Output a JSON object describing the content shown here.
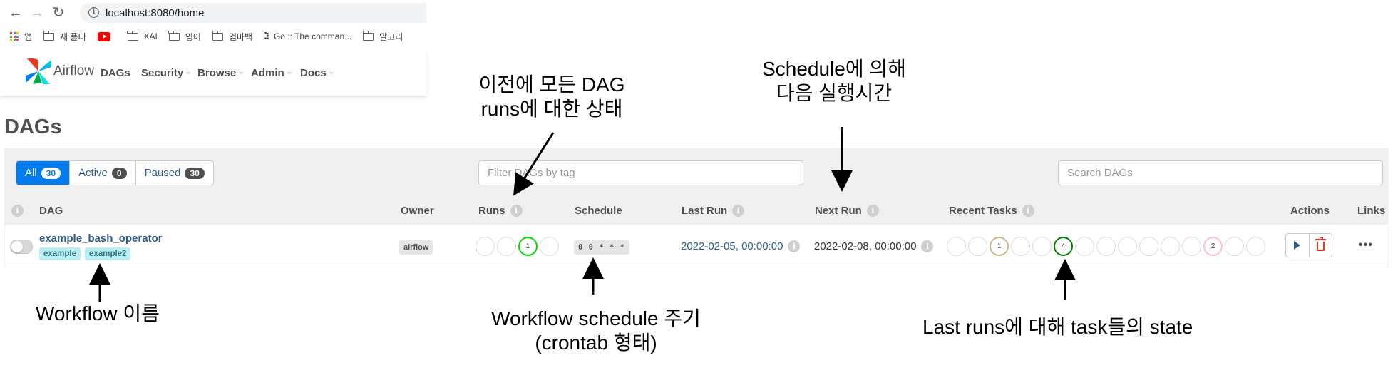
{
  "browser": {
    "url": "localhost:8080/home",
    "bookmarks": [
      {
        "icon": "apps-grid-icon",
        "label": "앱"
      },
      {
        "icon": "folder-icon",
        "label": "새 폴더"
      },
      {
        "icon": "youtube-icon",
        "label": ""
      },
      {
        "icon": "folder-icon",
        "label": "XAI"
      },
      {
        "icon": "folder-icon",
        "label": "영어"
      },
      {
        "icon": "folder-icon",
        "label": "엄마백"
      },
      {
        "icon": "go-gopher-icon",
        "label": "Go :: The comman..."
      },
      {
        "icon": "folder-icon",
        "label": "알고리"
      }
    ]
  },
  "navbar": {
    "brand": "Airflow",
    "items": [
      {
        "label": "DAGs",
        "dropdown": false
      },
      {
        "label": "Security",
        "dropdown": true
      },
      {
        "label": "Browse",
        "dropdown": true
      },
      {
        "label": "Admin",
        "dropdown": true
      },
      {
        "label": "Docs",
        "dropdown": true
      }
    ]
  },
  "page": {
    "title": "DAGs",
    "status_filters": [
      {
        "label": "All",
        "count": "30",
        "active": true
      },
      {
        "label": "Active",
        "count": "0",
        "active": false
      },
      {
        "label": "Paused",
        "count": "30",
        "active": false
      }
    ],
    "tag_filter_placeholder": "Filter DAGs by tag",
    "search_placeholder": "Search DAGs"
  },
  "table": {
    "headers": {
      "dag": "DAG",
      "owner": "Owner",
      "runs": "Runs",
      "schedule": "Schedule",
      "last_run": "Last Run",
      "next_run": "Next Run",
      "recent_tasks": "Recent Tasks",
      "actions": "Actions",
      "links": "Links"
    },
    "rows": [
      {
        "dag_id": "example_bash_operator",
        "paused": true,
        "tags": [
          "example",
          "example2"
        ],
        "owner": "airflow",
        "runs": [
          {
            "count": "",
            "color": "#dcdcdc"
          },
          {
            "count": "",
            "color": "#dcdcdc"
          },
          {
            "count": "1",
            "color": "#00e000",
            "state": "success"
          },
          {
            "count": "",
            "color": "#dcdcdc"
          }
        ],
        "schedule": "0 0 * * *",
        "last_run": "2022-02-05, 00:00:00",
        "next_run": "2022-02-08, 00:00:00",
        "recent_tasks": [
          {
            "count": "",
            "color": "#dcdcdc"
          },
          {
            "count": "",
            "color": "#dcdcdc"
          },
          {
            "count": "1",
            "color": "#d2b48c",
            "state": "removed"
          },
          {
            "count": "",
            "color": "#dcdcdc"
          },
          {
            "count": "",
            "color": "#dcdcdc"
          },
          {
            "count": "4",
            "color": "#008000",
            "state": "success"
          },
          {
            "count": "",
            "color": "#dcdcdc"
          },
          {
            "count": "",
            "color": "#dcdcdc"
          },
          {
            "count": "",
            "color": "#dcdcdc"
          },
          {
            "count": "",
            "color": "#dcdcdc"
          },
          {
            "count": "",
            "color": "#dcdcdc"
          },
          {
            "count": "",
            "color": "#dcdcdc"
          },
          {
            "count": "2",
            "color": "#ffc0cb",
            "state": "skipped"
          },
          {
            "count": "",
            "color": "#dcdcdc"
          },
          {
            "count": "",
            "color": "#dcdcdc"
          }
        ],
        "links_label": "•••"
      }
    ]
  },
  "annotations": {
    "runs_status": [
      "이전에 모든 DAG",
      "runs에 대한 상태"
    ],
    "next_run": [
      "Schedule에 의해",
      "다음 실행시간"
    ],
    "workflow_name": [
      "Workflow 이름"
    ],
    "schedule_cycle": [
      "Workflow schedule 주기",
      "(crontab 형태)"
    ],
    "task_states": [
      "Last runs에 대해 task들의 state"
    ]
  },
  "colors": {
    "accent": "#017cee",
    "link": "#2f5c8a",
    "tag_bg": "#bbeef2",
    "delete": "#e43921"
  }
}
